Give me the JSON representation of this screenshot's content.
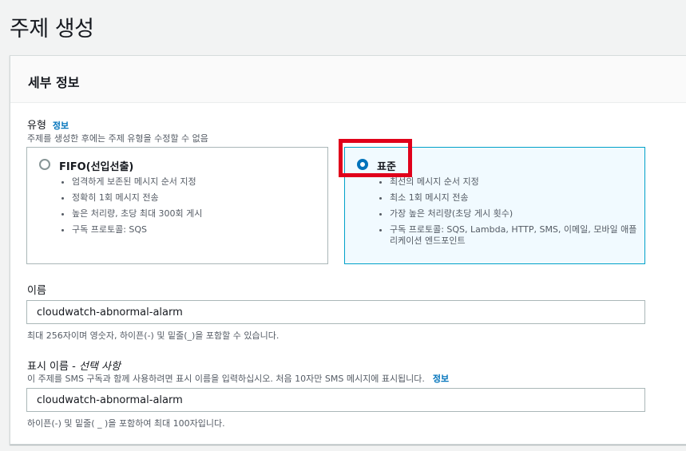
{
  "page": {
    "title": "주제 생성"
  },
  "details_panel": {
    "title": "세부 정보",
    "type_field": {
      "label": "유형",
      "info_link": "정보",
      "description": "주제를 생성한 후에는 주제 유형을 수정할 수 없음",
      "options": [
        {
          "title": "FIFO(선입선출)",
          "selected": false,
          "features": [
            "엄격하게 보존된 메시지 순서 지정",
            "정확히 1회 메시지 전송",
            "높은 처리량, 초당 최대 300회 게시",
            "구독 프로토콜: SQS"
          ]
        },
        {
          "title": "표준",
          "selected": true,
          "features": [
            "최선의 메시지 순서 지정",
            "최소 1회 메시지 전송",
            "가장 높은 처리량(초당 게시 횟수)",
            "구독 프로토콜: SQS, Lambda, HTTP, SMS, 이메일, 모바일 애플리케이션 엔드포인트"
          ]
        }
      ]
    },
    "name_field": {
      "label": "이름",
      "value": "cloudwatch-abnormal-alarm",
      "hint": "최대 256자이며 영숫자, 하이픈(-) 및 밑줄(_)을 포함할 수 있습니다."
    },
    "display_name_field": {
      "label": "표시 이름 - ",
      "label_optional": "선택 사항",
      "description": "이 주제를 SMS 구독과 함께 사용하려면 표시 이름을 입력하십시오. 처음 10자만 SMS 메시지에 표시됩니다.",
      "info_link": "정보",
      "value": "cloudwatch-abnormal-alarm",
      "hint": "하이픈(-) 및 밑줄( _ )을 포함하여 최대 100자입니다."
    }
  },
  "colors": {
    "highlight": "#e0001b",
    "link": "#0073bb",
    "selected_tile_bg": "#f1faff",
    "selected_tile_border": "#00a1c9"
  }
}
